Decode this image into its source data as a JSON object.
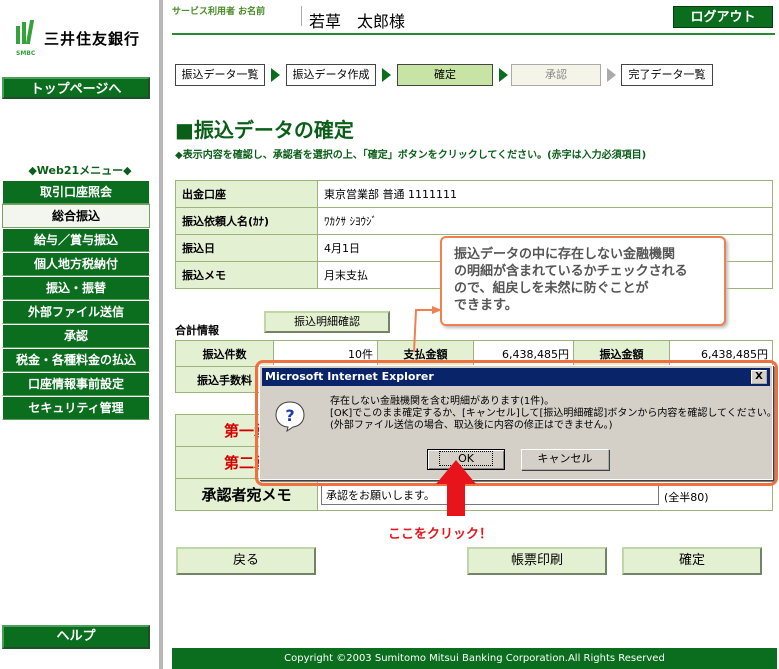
{
  "brand": {
    "name": "三井住友銀行",
    "sub": "SMBC",
    "color": "#0a6e1e"
  },
  "sidebar": {
    "top_page": "トップページへ",
    "web21_heading": "◆Web21メニュー◆",
    "menu": [
      {
        "label": "取引口座照会",
        "active": false
      },
      {
        "label": "総合振込",
        "active": true
      },
      {
        "label": "給与／賞与振込",
        "active": false
      },
      {
        "label": "個人地方税納付",
        "active": false
      },
      {
        "label": "振込・振替",
        "active": false
      },
      {
        "label": "外部ファイル送信",
        "active": false
      },
      {
        "label": "承認",
        "active": false
      },
      {
        "label": "税金・各種料金の払込",
        "active": false
      },
      {
        "label": "口座情報事前設定",
        "active": false
      },
      {
        "label": "セキュリティ管理",
        "active": false
      }
    ],
    "help": "ヘルプ"
  },
  "header": {
    "user_label": "サービス利用者 お名前",
    "user_name": "若草　太郎様",
    "logout": "ログアウト"
  },
  "steps": [
    {
      "label": "振込データ一覧",
      "state": "done"
    },
    {
      "label": "振込データ作成",
      "state": "done"
    },
    {
      "label": "確定",
      "state": "current"
    },
    {
      "label": "承認",
      "state": "future"
    },
    {
      "label": "完了データ一覧",
      "state": "done"
    }
  ],
  "page": {
    "title": "■振込データの確定",
    "instruction": "◆表示内容を確認し、承認者を選択の上、「確定」ボタンをクリックしてください。(赤字は入力必須項目)"
  },
  "detail": [
    {
      "label": "出金口座",
      "value": "東京営業部 普通 1111111"
    },
    {
      "label": "振込依頼人名(ｶﾅ)",
      "value": "ﾜｶｸｻ ｼﾖｳｼﾞ"
    },
    {
      "label": "振込日",
      "value": "4月1日"
    },
    {
      "label": "振込メモ",
      "value": "月末支払"
    }
  ],
  "tooltip": {
    "lines": [
      "振込データの中に存在しない金融機関",
      "の明細が含まれているかチェックされる",
      "ので、組戻しを未然に防ぐことが",
      "できます。"
    ]
  },
  "summary": {
    "label": "合計情報",
    "detail_button": "振込明細確認",
    "count_label": "振込件数",
    "count_value": "10件",
    "pay_label": "支払金額",
    "pay_value": "6,438,485円",
    "transfer_label": "振込金額",
    "transfer_value": "6,438,485円",
    "fee_label": "振込手数料"
  },
  "approver": {
    "first_label": "第一承",
    "second_label": "第二承",
    "memo_label": "承認者宛メモ",
    "memo_value": "承認をお願いします。",
    "memo_hint": "(全半80)"
  },
  "annotation": {
    "click_label": "ここをクリック！",
    "color": "#e8141c"
  },
  "buttons": {
    "back": "戻る",
    "print": "帳票印刷",
    "confirm": "確定"
  },
  "footer": {
    "copyright": "Copyright ©2003 Sumitomo Mitsui Banking Corporation.All Rights Reserved"
  },
  "dialog": {
    "title": "Microsoft Internet Explorer",
    "close": "X",
    "icon": "question-icon",
    "messages": [
      "存在しない金融機関を含む明細があります(1件)。",
      "[OK]でこのまま確定するか、[キャンセル]して[振込明細確認]ボタンから内容を確認してください。",
      "(外部ファイル送信の場合、取込後に内容の修正はできません。)"
    ],
    "ok": "OK",
    "cancel": "キャンセル"
  }
}
